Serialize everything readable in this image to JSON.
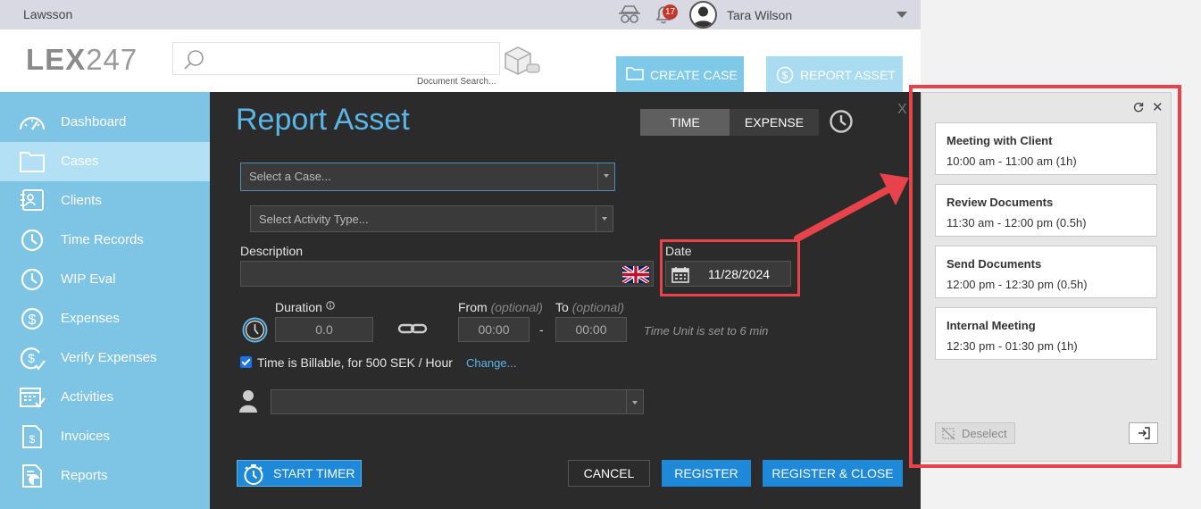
{
  "topbar": {
    "org": "Lawsson",
    "notification_count": "17",
    "user_name": "Tara Wilson"
  },
  "header": {
    "logo_bold": "LEX",
    "logo_light": "247",
    "search_placeholder": "",
    "search_caption": "Document Search...",
    "create_case_label": "CREATE CASE",
    "report_asset_label": "REPORT ASSET"
  },
  "sidebar": {
    "items": [
      {
        "label": "Dashboard",
        "icon": "gauge-icon"
      },
      {
        "label": "Cases",
        "icon": "folder-icon",
        "active": true
      },
      {
        "label": "Clients",
        "icon": "contacts-icon"
      },
      {
        "label": "Time Records",
        "icon": "clock-icon"
      },
      {
        "label": "WIP Eval",
        "icon": "clock-icon"
      },
      {
        "label": "Expenses",
        "icon": "dollar-icon"
      },
      {
        "label": "Verify Expenses",
        "icon": "dollar-check-icon"
      },
      {
        "label": "Activities",
        "icon": "calendar-icon"
      },
      {
        "label": "Invoices",
        "icon": "invoice-icon"
      },
      {
        "label": "Reports",
        "icon": "report-icon"
      }
    ]
  },
  "dialog": {
    "title": "Report Asset",
    "close_label": "X",
    "tabs": {
      "time": "TIME",
      "expense": "EXPENSE",
      "selected": "TIME"
    },
    "case_placeholder": "Select a Case...",
    "activity_placeholder": "Select Activity Type...",
    "description_label": "Description",
    "date_label": "Date",
    "date_value": "11/28/2024",
    "duration_label": "Duration",
    "duration_value": "0.0",
    "from_label": "From",
    "to_label": "To",
    "optional_text": "(optional)",
    "from_value": "00:00",
    "to_value": "00:00",
    "dash": "-",
    "time_unit_note": "Time Unit is set to 6 min",
    "billable_checked": true,
    "billable_text": "Time is Billable, for 500 SEK / Hour",
    "change_link": "Change...",
    "start_timer_label": "START TIMER",
    "cancel_label": "CANCEL",
    "register_label": "REGISTER",
    "register_close_label": "REGISTER & CLOSE"
  },
  "calendar_panel": {
    "events": [
      {
        "title": "Meeting with Client",
        "time": "10:00 am - 11:00 am (1h)"
      },
      {
        "title": "Review Documents",
        "time": "11:30 am - 12:00 pm (0.5h)"
      },
      {
        "title": "Send Documents",
        "time": "12:00 pm - 12:30 pm (0.5h)"
      },
      {
        "title": "Internal Meeting",
        "time": "12:30 pm - 01:30 pm (1h)"
      }
    ],
    "deselect_label": "Deselect"
  },
  "colors": {
    "accent_blue": "#1e88d9",
    "title_blue": "#5ab6e8",
    "sidebar_blue": "#7ec4e4",
    "highlight_red": "#e8434a",
    "dialog_bg": "#2b2b2b"
  }
}
